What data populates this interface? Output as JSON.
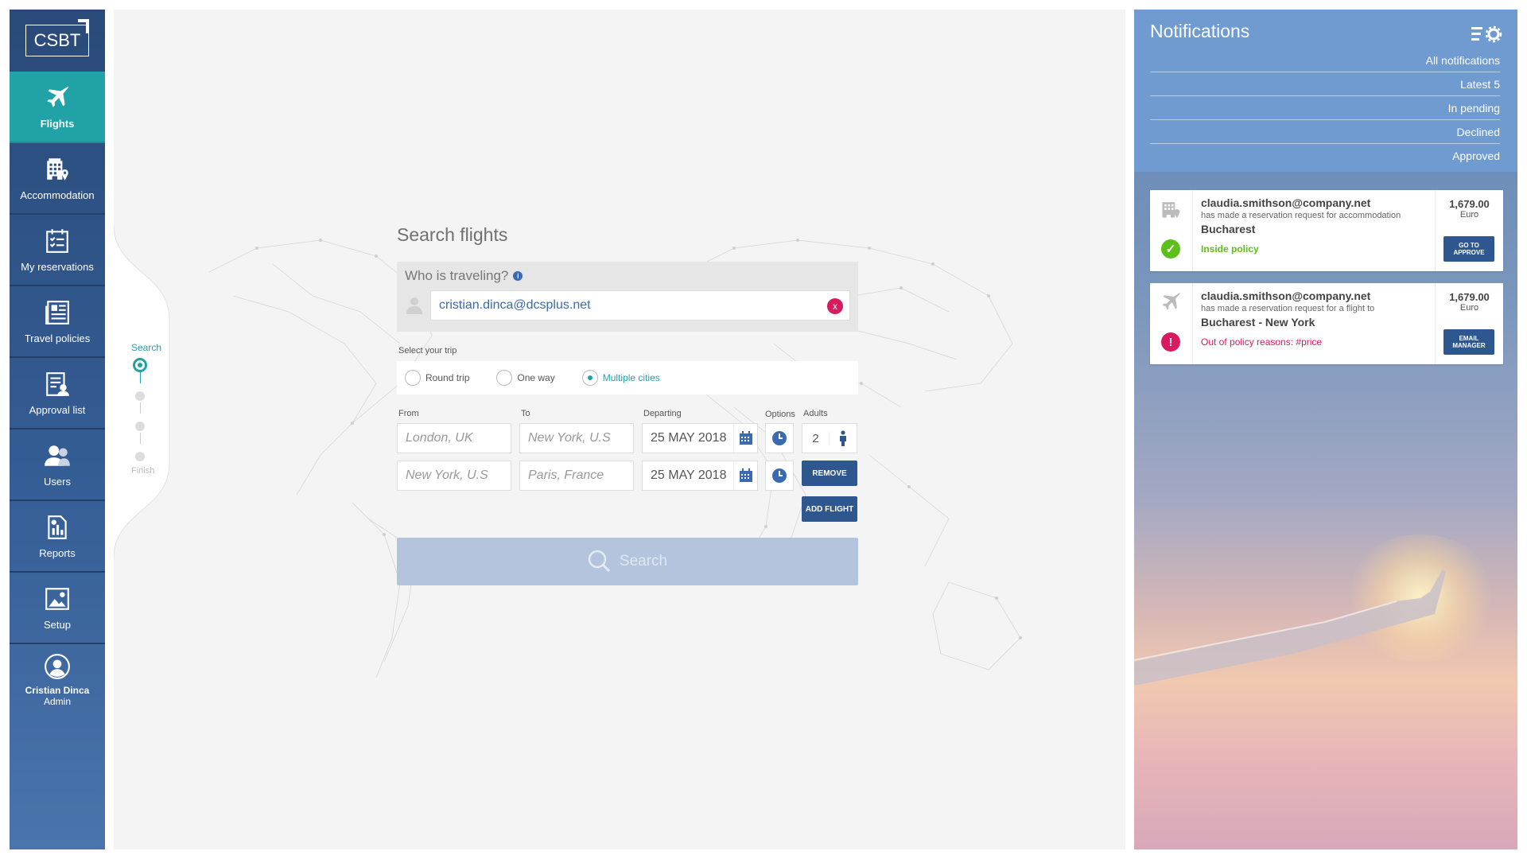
{
  "app": {
    "logo": "CSBT"
  },
  "sidebar": {
    "items": [
      {
        "label": "Flights",
        "icon": "airplane-icon",
        "active": true
      },
      {
        "label": "Accommodation",
        "icon": "hotel-icon"
      },
      {
        "label": "My reservations",
        "icon": "checklist-icon"
      },
      {
        "label": "Travel policies",
        "icon": "newspaper-icon"
      },
      {
        "label": "Approval list",
        "icon": "approval-icon"
      },
      {
        "label": "Users",
        "icon": "users-icon"
      },
      {
        "label": "Reports",
        "icon": "report-icon"
      },
      {
        "label": "Setup",
        "icon": "setup-icon"
      }
    ],
    "user": {
      "name": "Cristian Dinca",
      "role": "Admin"
    }
  },
  "stepper": {
    "first": "Search",
    "last": "Finish"
  },
  "search": {
    "title": "Search flights",
    "who_label": "Who is traveling?",
    "traveler_email": "cristian.dinca@dcsplus.net",
    "clear": "x",
    "trip_label": "Select your trip",
    "trip_types": [
      "Round trip",
      "One way",
      "Multiple cities"
    ],
    "trip_selected": "Multiple cities",
    "columns": {
      "from": "From",
      "to": "To",
      "departing": "Departing",
      "options": "Options",
      "adults": "Adults"
    },
    "legs": [
      {
        "from": "London, UK",
        "to": "New York, U.S",
        "date": "25 MAY 2018"
      },
      {
        "from": "New York, U.S",
        "to": "Paris, France",
        "date": "25 MAY 2018"
      }
    ],
    "adults": "2",
    "remove_label": "REMOVE",
    "add_flight_label": "ADD FLIGHT",
    "search_label": "Search"
  },
  "notifications": {
    "title": "Notifications",
    "filters": [
      "All notifications",
      "Latest 5",
      "In pending",
      "Declined",
      "Approved"
    ],
    "cards": [
      {
        "email": "claudia.smithson@company.net",
        "desc": "has made a reservation request for accommodation",
        "dest": "Bucharest",
        "status": "Inside policy",
        "price": "1,679.00",
        "currency": "Euro",
        "action": "GO TO APPROVE"
      },
      {
        "email": "claudia.smithson@company.net",
        "desc": "has made a reservation request for a flight to",
        "dest": "Bucharest - New York",
        "status": "Out of policy reasons: #price",
        "price": "1,679.00",
        "currency": "Euro",
        "action": "EMAIL MANAGER"
      }
    ]
  },
  "colors": {
    "accent": "#21a2a6",
    "primary": "#2e578f",
    "sidebar": "#345d95",
    "danger": "#d81b60",
    "ok": "#5cbf1a"
  }
}
